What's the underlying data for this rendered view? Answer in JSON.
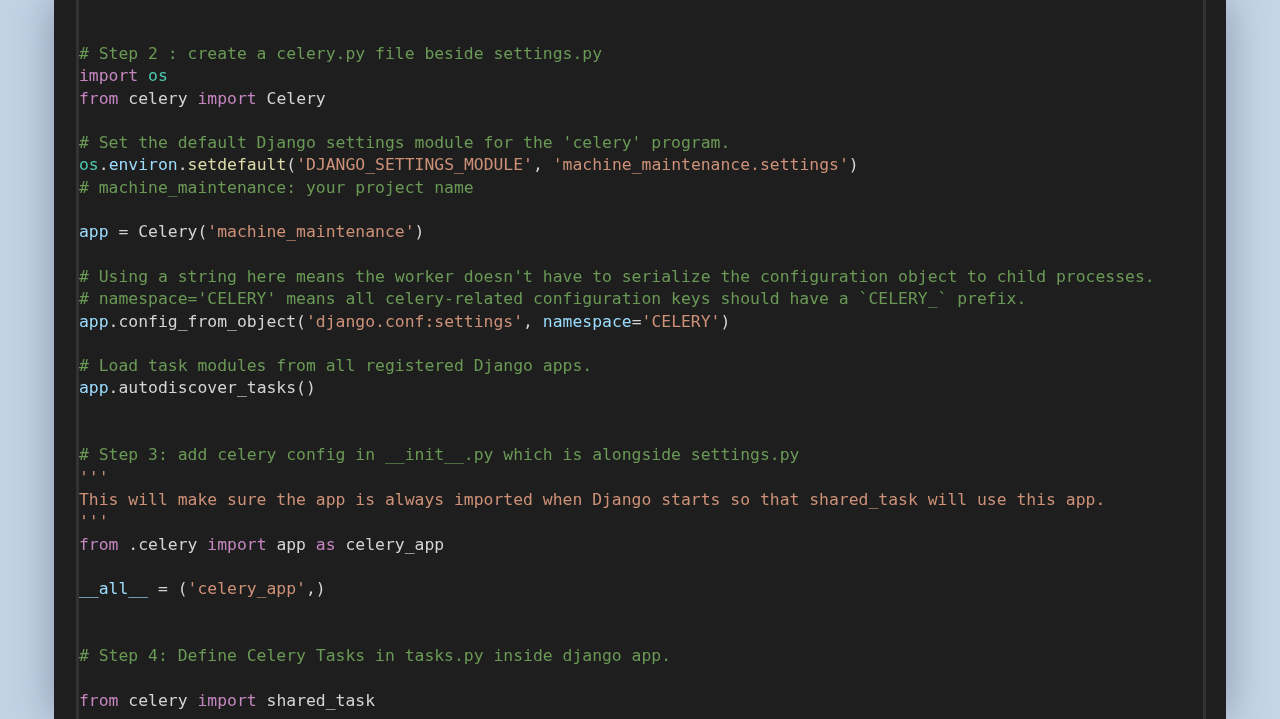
{
  "editor": {
    "lines": [
      {
        "kind": "code",
        "tokens": [
          {
            "kind": "comment",
            "t": "# Step 2 : create a celery.py file beside settings.py"
          }
        ]
      },
      {
        "kind": "code",
        "tokens": [
          {
            "kind": "keyword",
            "t": "import "
          },
          {
            "kind": "module",
            "t": "os"
          }
        ]
      },
      {
        "kind": "code",
        "tokens": [
          {
            "kind": "keyword",
            "t": "from"
          },
          {
            "kind": "plain",
            "t": " celery "
          },
          {
            "kind": "keyword",
            "t": "import"
          },
          {
            "kind": "plain",
            "t": " Celery"
          }
        ]
      },
      {
        "kind": "blank"
      },
      {
        "kind": "code",
        "tokens": [
          {
            "kind": "comment",
            "t": "# Set the default Django settings module for the 'celery' program."
          }
        ]
      },
      {
        "kind": "code",
        "tokens": [
          {
            "kind": "module",
            "t": "os"
          },
          {
            "kind": "plain",
            "t": "."
          },
          {
            "kind": "variable",
            "t": "environ"
          },
          {
            "kind": "plain",
            "t": "."
          },
          {
            "kind": "function",
            "t": "setdefault"
          },
          {
            "kind": "plain",
            "t": "("
          },
          {
            "kind": "string",
            "t": "'DJANGO_SETTINGS_MODULE'"
          },
          {
            "kind": "plain",
            "t": ", "
          },
          {
            "kind": "string",
            "t": "'machine_maintenance.settings'"
          },
          {
            "kind": "plain",
            "t": ")"
          }
        ]
      },
      {
        "kind": "code",
        "tokens": [
          {
            "kind": "comment",
            "t": "# machine_maintenance: your project name"
          }
        ]
      },
      {
        "kind": "blank"
      },
      {
        "kind": "code",
        "tokens": [
          {
            "kind": "variable",
            "t": "app"
          },
          {
            "kind": "plain",
            "t": " = Celery("
          },
          {
            "kind": "string",
            "t": "'machine_maintenance'"
          },
          {
            "kind": "plain",
            "t": ")"
          }
        ]
      },
      {
        "kind": "blank"
      },
      {
        "kind": "code",
        "tokens": [
          {
            "kind": "comment",
            "t": "# Using a string here means the worker doesn't have to serialize the configuration object to child processes."
          }
        ]
      },
      {
        "kind": "code",
        "tokens": [
          {
            "kind": "comment",
            "t": "# namespace='CELERY' means all celery-related configuration keys should have a `CELERY_` prefix."
          }
        ]
      },
      {
        "kind": "code",
        "tokens": [
          {
            "kind": "variable",
            "t": "app"
          },
          {
            "kind": "plain",
            "t": ".config_from_object("
          },
          {
            "kind": "string",
            "t": "'django.conf:settings'"
          },
          {
            "kind": "plain",
            "t": ", "
          },
          {
            "kind": "variable",
            "t": "namespace"
          },
          {
            "kind": "plain",
            "t": "="
          },
          {
            "kind": "string",
            "t": "'CELERY'"
          },
          {
            "kind": "plain",
            "t": ")"
          }
        ]
      },
      {
        "kind": "blank"
      },
      {
        "kind": "code",
        "tokens": [
          {
            "kind": "comment",
            "t": "# Load task modules from all registered Django apps."
          }
        ]
      },
      {
        "kind": "code",
        "tokens": [
          {
            "kind": "variable",
            "t": "app"
          },
          {
            "kind": "plain",
            "t": ".autodiscover_tasks()"
          }
        ]
      },
      {
        "kind": "blank"
      },
      {
        "kind": "blank"
      },
      {
        "kind": "code",
        "tokens": [
          {
            "kind": "comment",
            "t": "# Step 3: add celery config in __init__.py which is alongside settings.py"
          }
        ]
      },
      {
        "kind": "code",
        "tokens": [
          {
            "kind": "string",
            "t": "'''"
          }
        ]
      },
      {
        "kind": "code",
        "tokens": [
          {
            "kind": "string",
            "t": "This will make sure the app is always imported when Django starts so that shared_task will use this app."
          }
        ]
      },
      {
        "kind": "code",
        "tokens": [
          {
            "kind": "string",
            "t": "'''"
          }
        ]
      },
      {
        "kind": "code",
        "tokens": [
          {
            "kind": "keyword",
            "t": "from"
          },
          {
            "kind": "plain",
            "t": " .celery "
          },
          {
            "kind": "keyword",
            "t": "import"
          },
          {
            "kind": "plain",
            "t": " app "
          },
          {
            "kind": "keyword",
            "t": "as"
          },
          {
            "kind": "plain",
            "t": " celery_app"
          }
        ]
      },
      {
        "kind": "blank"
      },
      {
        "kind": "code",
        "tokens": [
          {
            "kind": "variable",
            "t": "__all__"
          },
          {
            "kind": "plain",
            "t": " = ("
          },
          {
            "kind": "string",
            "t": "'celery_app'"
          },
          {
            "kind": "plain",
            "t": ",)"
          }
        ]
      },
      {
        "kind": "blank"
      },
      {
        "kind": "blank"
      },
      {
        "kind": "code",
        "tokens": [
          {
            "kind": "comment",
            "t": "# Step 4: Define Celery Tasks in tasks.py inside django app."
          }
        ]
      },
      {
        "kind": "blank"
      },
      {
        "kind": "code",
        "tokens": [
          {
            "kind": "keyword",
            "t": "from"
          },
          {
            "kind": "plain",
            "t": " celery "
          },
          {
            "kind": "keyword",
            "t": "import"
          },
          {
            "kind": "plain",
            "t": " shared_task"
          }
        ]
      }
    ]
  }
}
